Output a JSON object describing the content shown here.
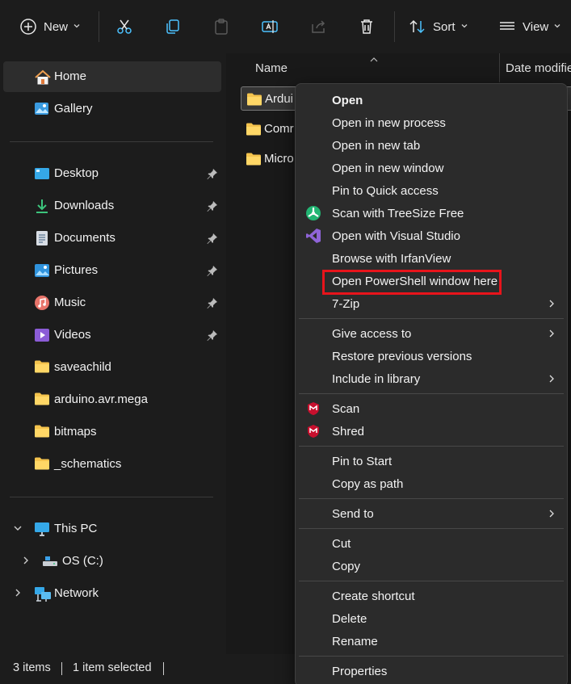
{
  "toolbar": {
    "new_label": "New",
    "sort_label": "Sort",
    "view_label": "View"
  },
  "nav": {
    "home": "Home",
    "gallery": "Gallery",
    "desktop": "Desktop",
    "downloads": "Downloads",
    "documents": "Documents",
    "pictures": "Pictures",
    "music": "Music",
    "videos": "Videos",
    "folder1": "saveachild",
    "folder2": "arduino.avr.mega",
    "folder3": "bitmaps",
    "folder4": "_schematics",
    "this_pc": "This PC",
    "os_c": "OS (C:)",
    "network": "Network"
  },
  "content": {
    "col_name": "Name",
    "col_date": "Date modifie",
    "rows": [
      "Ardui",
      "Comr",
      "Micro"
    ]
  },
  "menu": {
    "open": "Open",
    "open_new_process": "Open in new process",
    "open_new_tab": "Open in new tab",
    "open_new_window": "Open in new window",
    "pin_quick": "Pin to Quick access",
    "treesize": "Scan with TreeSize Free",
    "visual_studio": "Open with Visual Studio",
    "irfanview": "Browse with IrfanView",
    "powershell": "Open PowerShell window here",
    "sevenzip": "7-Zip",
    "give_access": "Give access to",
    "restore": "Restore previous versions",
    "include_library": "Include in library",
    "scan": "Scan",
    "shred": "Shred",
    "pin_start": "Pin to Start",
    "copy_path": "Copy as path",
    "send_to": "Send to",
    "cut": "Cut",
    "copy": "Copy",
    "create_shortcut": "Create shortcut",
    "delete": "Delete",
    "rename": "Rename",
    "properties": "Properties"
  },
  "status": {
    "items": "3 items",
    "selected": "1 item selected"
  },
  "colors": {
    "highlight_box": "#e8141b",
    "folder": "#f4c34d",
    "accent": "#4cc2ff"
  }
}
